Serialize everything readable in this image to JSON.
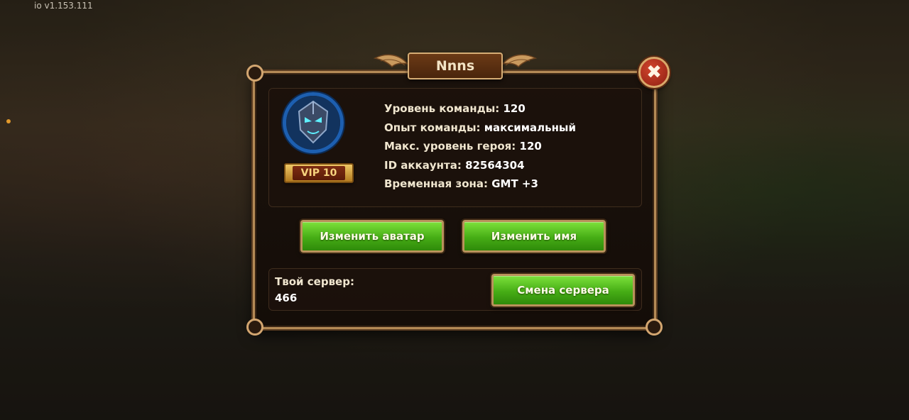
{
  "app": {
    "version": "io v1.153.111"
  },
  "dialog": {
    "title": "Nnns",
    "close_label": "✖",
    "vip": "VIP 10",
    "stats": [
      {
        "label": "Уровень команды:",
        "value": "120"
      },
      {
        "label": "Опыт команды:",
        "value": "максимальный"
      },
      {
        "label": "Макс. уровень героя:",
        "value": "120"
      },
      {
        "label": "ID аккаунта:",
        "value": "82564304"
      },
      {
        "label": "Временная зона:",
        "value": "GMT +3"
      }
    ],
    "buttons": {
      "change_avatar": "Изменить аватар",
      "change_name": "Изменить имя",
      "change_server": "Смена сервера"
    },
    "server": {
      "label": "Твой сервер:",
      "number": "466"
    }
  },
  "icons": {
    "close": "close-icon",
    "avatar": "hero-portrait",
    "wings": "wing-ornament-icon"
  },
  "colors": {
    "accent_green": "#46ad15",
    "frame_gold": "#b48a56",
    "close_red": "#c23a22"
  }
}
